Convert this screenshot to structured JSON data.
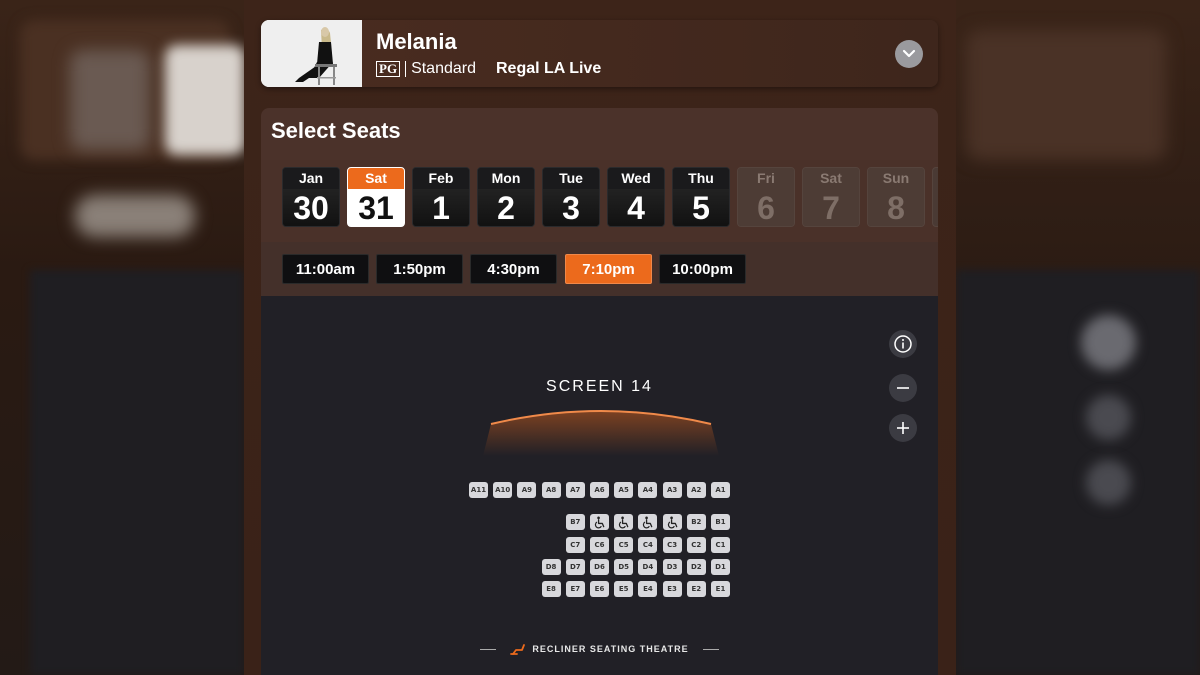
{
  "movie": {
    "title": "Melania",
    "rating": "PG",
    "format": "Standard",
    "theatre": "Regal LA Live"
  },
  "panel": {
    "title": "Select Seats"
  },
  "dates": [
    {
      "dow": "Jan",
      "day": "30",
      "state": "available"
    },
    {
      "dow": "Sat",
      "day": "31",
      "state": "selected"
    },
    {
      "dow": "Feb",
      "day": "1",
      "state": "available"
    },
    {
      "dow": "Mon",
      "day": "2",
      "state": "available"
    },
    {
      "dow": "Tue",
      "day": "3",
      "state": "available"
    },
    {
      "dow": "Wed",
      "day": "4",
      "state": "available"
    },
    {
      "dow": "Thu",
      "day": "5",
      "state": "available"
    },
    {
      "dow": "Fri",
      "day": "6",
      "state": "disabled"
    },
    {
      "dow": "Sat",
      "day": "7",
      "state": "disabled"
    },
    {
      "dow": "Sun",
      "day": "8",
      "state": "disabled"
    }
  ],
  "times": [
    {
      "label": "11:00am",
      "selected": false
    },
    {
      "label": "1:50pm",
      "selected": false
    },
    {
      "label": "4:30pm",
      "selected": false
    },
    {
      "label": "7:10pm",
      "selected": true
    },
    {
      "label": "10:00pm",
      "selected": false
    }
  ],
  "screen": {
    "label": "SCREEN 14"
  },
  "seat_rows": [
    {
      "row": "A",
      "seats": [
        "A11",
        "A10",
        "A9",
        "A8",
        "A7",
        "A6",
        "A5",
        "A4",
        "A3",
        "A2",
        "A1"
      ]
    },
    {
      "row": "B",
      "seats": [
        "B7",
        "WC",
        "WC",
        "WC",
        "WC",
        "B2",
        "B1"
      ]
    },
    {
      "row": "C",
      "seats": [
        "C7",
        "C6",
        "C5",
        "C4",
        "C3",
        "C2",
        "C1"
      ]
    },
    {
      "row": "D",
      "seats": [
        "D8",
        "D7",
        "D6",
        "D5",
        "D4",
        "D3",
        "D2",
        "D1"
      ]
    },
    {
      "row": "E",
      "seats": [
        "E8",
        "E7",
        "E6",
        "E5",
        "E4",
        "E3",
        "E2",
        "E1"
      ]
    }
  ],
  "footer": {
    "label": "RECLINER SEATING THEATRE"
  },
  "colors": {
    "accent": "#ec6a1c",
    "seat": "#d8d8dc",
    "map_bg": "#212026",
    "panel_bg": "#4b322a"
  },
  "icons": {
    "expand": "chevron-down-icon",
    "info": "info-icon",
    "zoom_out": "minus-icon",
    "zoom_in": "plus-icon",
    "wheelchair": "wheelchair-icon",
    "recliner": "recliner-icon"
  }
}
